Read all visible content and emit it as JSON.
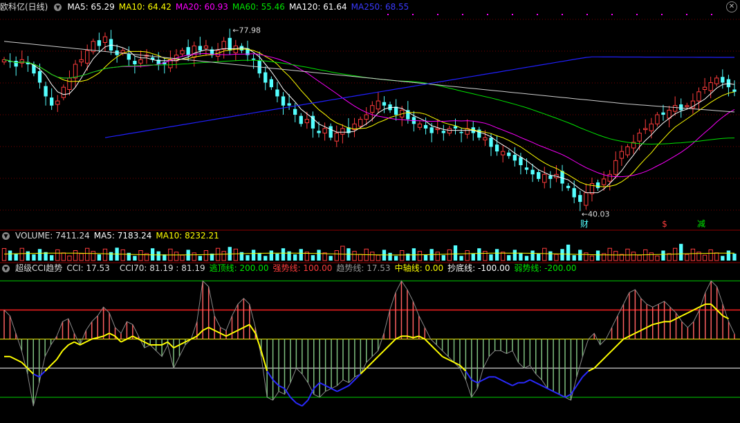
{
  "main_header": {
    "title": "欧科亿(日线)",
    "ma5": "MA5: 65.29",
    "ma10": "MA10: 64.42",
    "ma20": "MA20: 60.93",
    "ma60": "MA60: 55.46",
    "ma120": "MA120: 61.64",
    "ma250": "MA250: 68.55"
  },
  "volume_header": {
    "volume": "VOLUME: 7411.24",
    "ma5": "MA5: 7183.24",
    "ma10": "MA10: 8232.21"
  },
  "cci_header": {
    "name": "超级CCI趋势",
    "cci": "CCI: 17.53",
    "cci70": "CCI70: 81.19 : 81.19",
    "escape": "逃顶线: 200.00",
    "strong": "强势线: 100.00",
    "trend": "趋势线: 17.53",
    "mid": "中轴线: 0.00",
    "bottom": "抄底线: -100.00",
    "weak": "弱势线: -200.00"
  },
  "icons": {
    "collapse": "chevron-down-icon",
    "close": "close-icon"
  },
  "colors": {
    "up": "#ff3c3c",
    "down": "#54ffff",
    "ma5": "#ffffff",
    "ma10": "#ffff00",
    "ma20": "#ff00ff",
    "ma60": "#00e600",
    "ma120": "#ffffff",
    "ma250": "#0000ff",
    "cci_line": "#ffff00",
    "cci_low": "#0000ff"
  },
  "chart_data": [
    {
      "type": "candlestick",
      "title": "欧科亿(日线)",
      "ylim": [
        38,
        82
      ],
      "max_label": "77.98",
      "min_label": "40.03",
      "event_labels": [
        "财",
        "$",
        "减"
      ],
      "closes": [
        72,
        71.5,
        70.5,
        72,
        71,
        69,
        67,
        64,
        62,
        63,
        66,
        68,
        71,
        72,
        74,
        76,
        75,
        77,
        74,
        73,
        74,
        72,
        71,
        72,
        73,
        72,
        71,
        71,
        72,
        73,
        74,
        73,
        75,
        74,
        75,
        73,
        74,
        76,
        74,
        75,
        74,
        73,
        72,
        69,
        67,
        66,
        64,
        62,
        62,
        60,
        58,
        59,
        57,
        56,
        57,
        55,
        56,
        57,
        56,
        58,
        59,
        60,
        62,
        63,
        62,
        61,
        60,
        61,
        59,
        58,
        58,
        57,
        56,
        57,
        56,
        57,
        57,
        56,
        57,
        56,
        55,
        55,
        53,
        52,
        52,
        51,
        50,
        49,
        48,
        47,
        46,
        47,
        46,
        47,
        45,
        44,
        42,
        41,
        43,
        45,
        44,
        46,
        47,
        50,
        52,
        53,
        54,
        56,
        57,
        58,
        60,
        60,
        61,
        62,
        61,
        62,
        63,
        65,
        66,
        67,
        68,
        67,
        66,
        65
      ],
      "ma5_last": 65.29,
      "ma10_last": 64.42,
      "ma20_last": 60.93,
      "ma60_last": 55.46,
      "ma120_last": 61.64,
      "ma250_last": 68.55
    },
    {
      "type": "bar",
      "title": "VOLUME",
      "last": 7411.24,
      "ma5_last": 7183.24,
      "ma10_last": 8232.21
    },
    {
      "type": "area",
      "title": "超级CCI趋势",
      "ylim": [
        -260,
        220
      ],
      "levels": [
        200,
        100,
        0,
        -100,
        -200
      ],
      "cci": [
        100,
        80,
        20,
        -40,
        -120,
        -230,
        -150,
        -60,
        -20,
        10,
        60,
        70,
        20,
        -20,
        30,
        60,
        80,
        110,
        90,
        40,
        20,
        60,
        50,
        10,
        -30,
        -20,
        -40,
        -60,
        -20,
        -100,
        -60,
        -20,
        0,
        60,
        200,
        180,
        80,
        40,
        30,
        80,
        120,
        140,
        120,
        40,
        -60,
        -200,
        -210,
        -180,
        -190,
        -150,
        -100,
        -120,
        -150,
        -190,
        -200,
        -180,
        -170,
        -160,
        -140,
        -150,
        -130,
        -120,
        -80,
        -60,
        -40,
        20,
        100,
        160,
        200,
        170,
        130,
        80,
        40,
        0,
        -20,
        -40,
        -60,
        -80,
        -100,
        -140,
        -200,
        -170,
        -100,
        -60,
        -40,
        -40,
        -50,
        -40,
        -80,
        -100,
        -90,
        -120,
        -140,
        -170,
        -180,
        -190,
        -200,
        -210,
        -130,
        -60,
        0,
        20,
        -20,
        0,
        40,
        80,
        120,
        160,
        170,
        140,
        120,
        110,
        120,
        130,
        110,
        90,
        60,
        40,
        60,
        100,
        160,
        200,
        180,
        120,
        60,
        17.53
      ],
      "trend": [
        -60,
        -60,
        -70,
        -80,
        -100,
        -120,
        -130,
        -110,
        -90,
        -70,
        -40,
        -20,
        -10,
        -20,
        -10,
        0,
        5,
        10,
        20,
        10,
        -10,
        0,
        10,
        0,
        -10,
        -20,
        -20,
        -20,
        -10,
        -30,
        -20,
        -10,
        0,
        10,
        30,
        40,
        30,
        20,
        10,
        20,
        30,
        40,
        50,
        20,
        -40,
        -110,
        -140,
        -160,
        -170,
        -200,
        -220,
        -230,
        -210,
        -170,
        -150,
        -160,
        -170,
        -180,
        -170,
        -160,
        -140,
        -120,
        -100,
        -80,
        -60,
        -40,
        -20,
        0,
        10,
        10,
        5,
        10,
        0,
        -20,
        -40,
        -60,
        -70,
        -80,
        -90,
        -110,
        -140,
        -150,
        -140,
        -130,
        -130,
        -140,
        -150,
        -160,
        -150,
        -150,
        -140,
        -150,
        -160,
        -170,
        -180,
        -190,
        -200,
        -190,
        -160,
        -130,
        -110,
        -100,
        -80,
        -60,
        -40,
        -20,
        0,
        10,
        20,
        30,
        40,
        50,
        55,
        60,
        60,
        70,
        80,
        90,
        100,
        110,
        120,
        120,
        100,
        80,
        70
      ]
    }
  ]
}
